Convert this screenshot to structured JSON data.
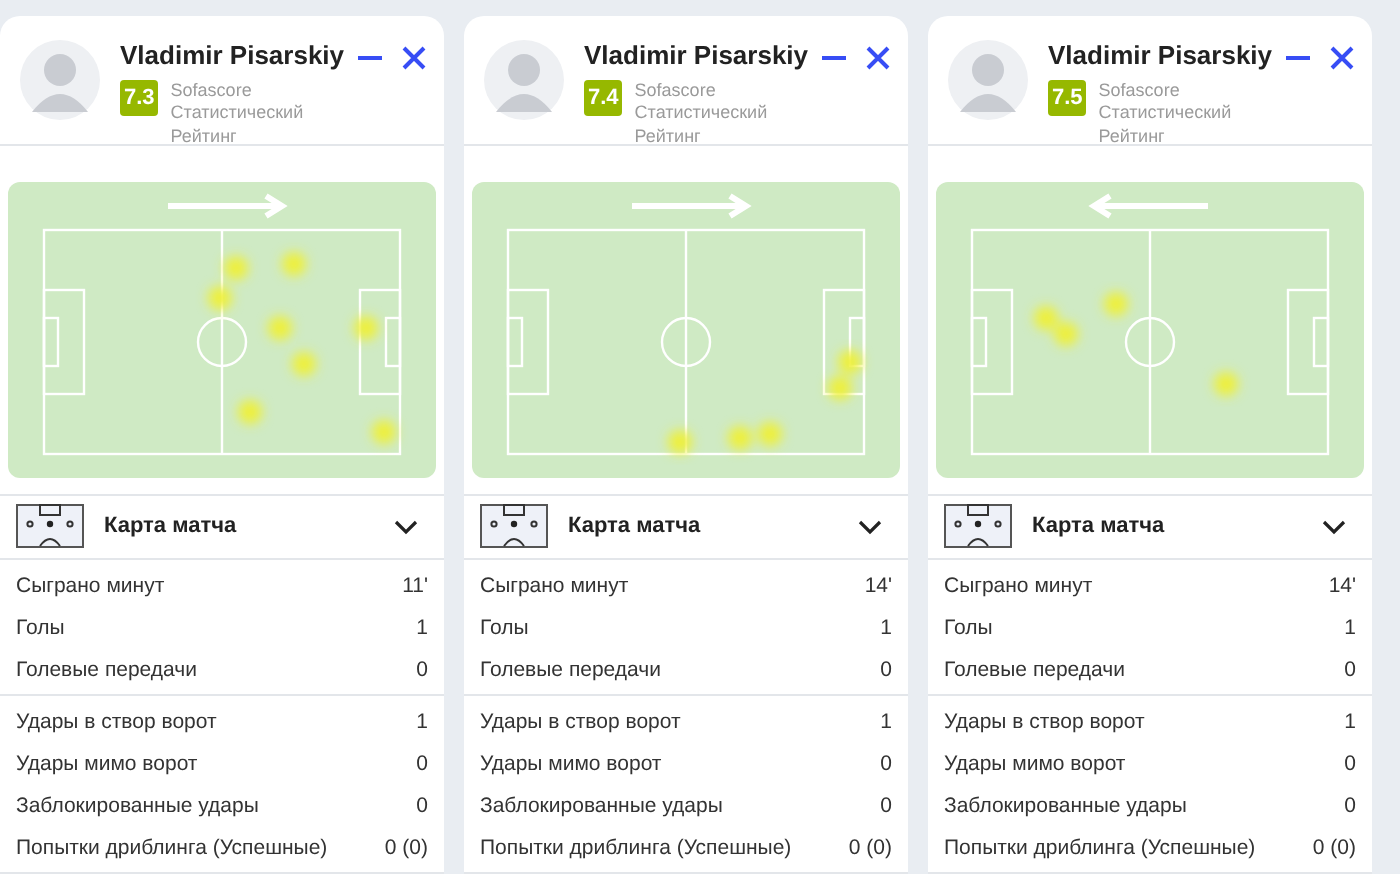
{
  "panels": [
    {
      "player": {
        "name": "Vladimir Pisarskiy",
        "rating": "7.3",
        "rating_label": "Sofascore Статистический Рейтинг"
      },
      "heatmap": {
        "arrow_points_left": false
      },
      "match_map": {
        "label": "Карта матча",
        "expanded": false
      },
      "stat_groups": [
        [
          {
            "label": "Сыграно минут",
            "value": "11'"
          },
          {
            "label": "Голы",
            "value": "1"
          },
          {
            "label": "Голевые передачи",
            "value": "0"
          }
        ],
        [
          {
            "label": "Удары в створ ворот",
            "value": "1"
          },
          {
            "label": "Удары мимо ворот",
            "value": "0"
          },
          {
            "label": "Заблокированные удары",
            "value": "0"
          },
          {
            "label": "Попытки дриблинга (Успешные)",
            "value": "0 (0)"
          }
        ]
      ]
    },
    {
      "player": {
        "name": "Vladimir Pisarskiy",
        "rating": "7.4",
        "rating_label": "Sofascore Статистический Рейтинг"
      },
      "heatmap": {
        "arrow_points_left": false
      },
      "match_map": {
        "label": "Карта матча",
        "expanded": false
      },
      "stat_groups": [
        [
          {
            "label": "Сыграно минут",
            "value": "14'"
          },
          {
            "label": "Голы",
            "value": "1"
          },
          {
            "label": "Голевые передачи",
            "value": "0"
          }
        ],
        [
          {
            "label": "Удары в створ ворот",
            "value": "1"
          },
          {
            "label": "Удары мимо ворот",
            "value": "0"
          },
          {
            "label": "Заблокированные удары",
            "value": "0"
          },
          {
            "label": "Попытки дриблинга (Успешные)",
            "value": "0 (0)"
          }
        ]
      ]
    },
    {
      "player": {
        "name": "Vladimir Pisarskiy",
        "rating": "7.5",
        "rating_label": "Sofascore Статистический Рейтинг"
      },
      "heatmap": {
        "arrow_points_left": true
      },
      "match_map": {
        "label": "Карта матча",
        "expanded": false
      },
      "stat_groups": [
        [
          {
            "label": "Сыграно минут",
            "value": "14'"
          },
          {
            "label": "Голы",
            "value": "1"
          },
          {
            "label": "Голевые передачи",
            "value": "0"
          }
        ],
        [
          {
            "label": "Удары в створ ворот",
            "value": "1"
          },
          {
            "label": "Удары мимо ворот",
            "value": "0"
          },
          {
            "label": "Заблокированные удары",
            "value": "0"
          },
          {
            "label": "Попытки дриблинга (Успешные)",
            "value": "0 (0)"
          }
        ]
      ]
    }
  ]
}
